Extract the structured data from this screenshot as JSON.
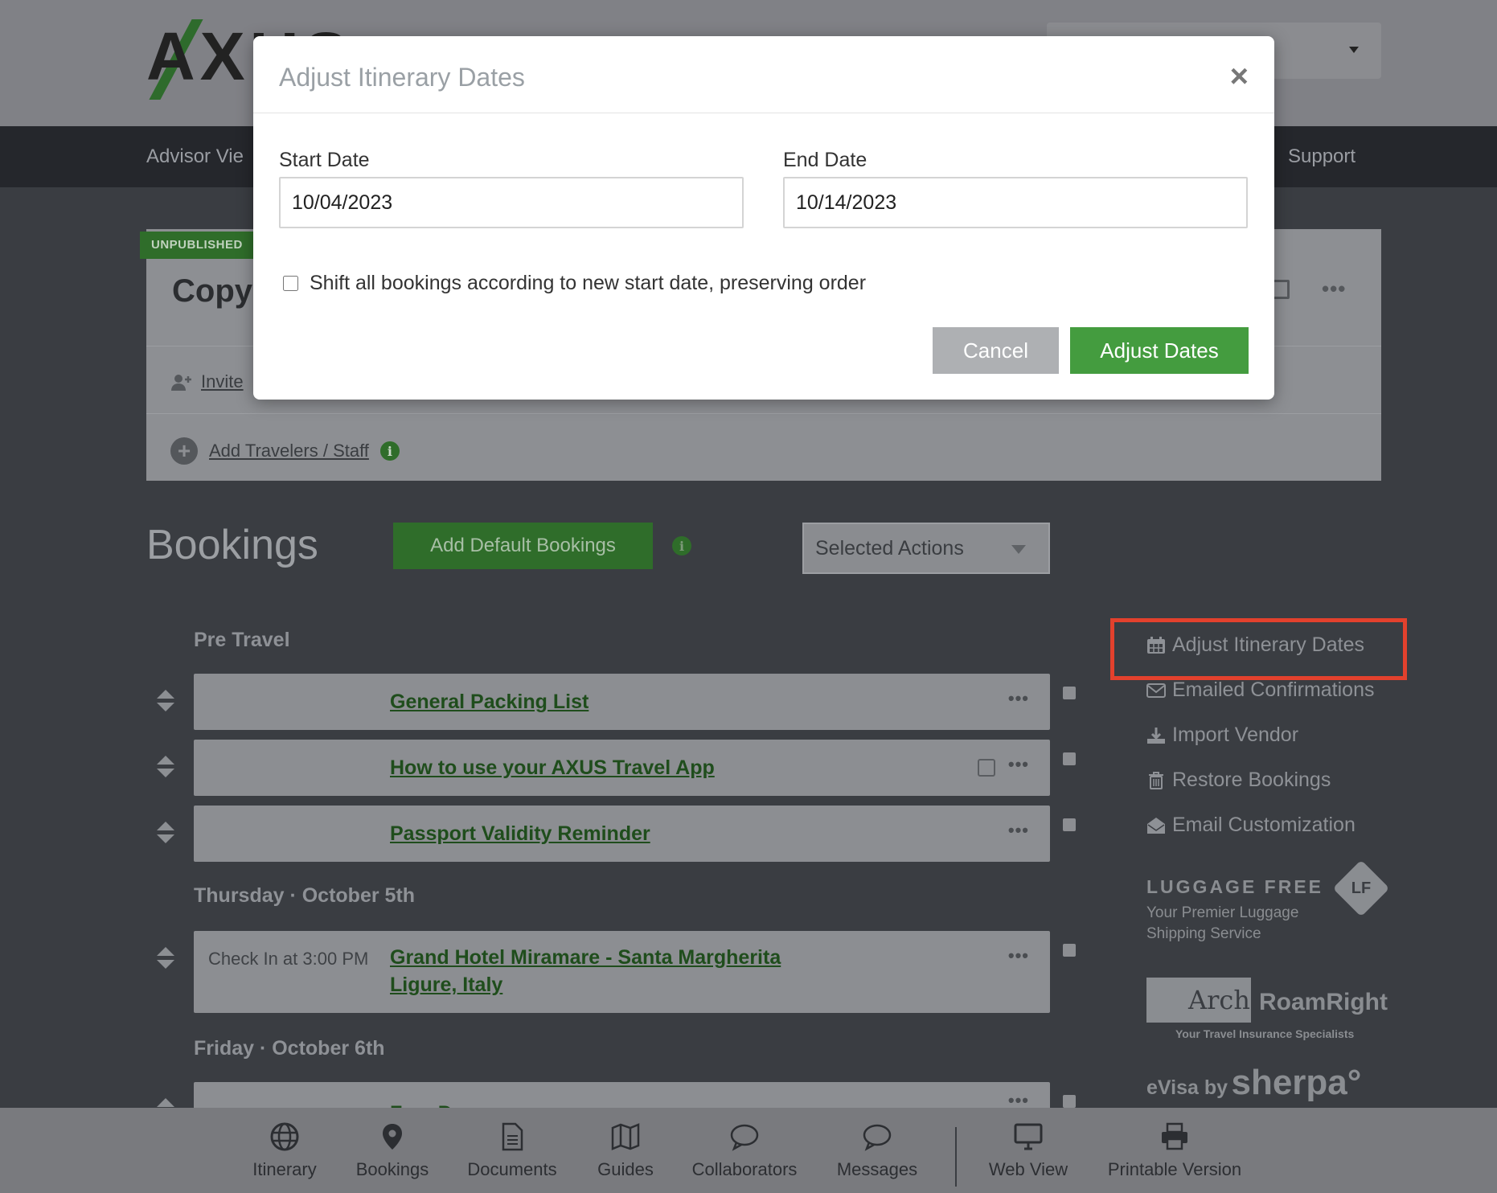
{
  "header": {
    "logo_text": "AXUS",
    "nav": {
      "advisor_view": "Advisor Vie",
      "support": "Support"
    }
  },
  "trip": {
    "status_badge": "UNPUBLISHED",
    "title": "Copy",
    "invite_label": "Invite",
    "add_travelers_label": "Add Travelers / Staff"
  },
  "bookings": {
    "title": "Bookings",
    "add_default_label": "Add Default Bookings",
    "selected_actions_label": "Selected Actions",
    "sections": [
      {
        "heading": "Pre Travel"
      },
      {
        "heading": "Thursday · October 5th"
      },
      {
        "heading": "Friday · October 6th"
      }
    ],
    "rows": [
      {
        "title": "General Packing List",
        "time": ""
      },
      {
        "title": "How to use your AXUS Travel App",
        "time": ""
      },
      {
        "title": "Passport Validity Reminder",
        "time": ""
      },
      {
        "title_line1": "Grand Hotel Miramare - Santa Margherita",
        "title_line2": "Ligure, Italy",
        "time": "Check In at 3:00 PM"
      },
      {
        "title": "Free Day",
        "time": ""
      }
    ]
  },
  "sidebar": {
    "links": [
      {
        "label": "Adjust Itinerary Dates",
        "icon": "calendar-icon"
      },
      {
        "label": "Emailed Confirmations",
        "icon": "envelope-icon"
      },
      {
        "label": "Import Vendor",
        "icon": "download-icon"
      },
      {
        "label": "Restore Bookings",
        "icon": "trash-icon"
      },
      {
        "label": "Email Customization",
        "icon": "open-envelope-icon"
      }
    ],
    "partners": {
      "luggage_free": {
        "name": "LUGGAGE FREE",
        "tagline_1": "Your Premier Luggage",
        "tagline_2": "Shipping Service",
        "badge": "LF"
      },
      "arch": {
        "name": "Arch",
        "right": "RoamRight",
        "tagline": "Your Travel Insurance Specialists"
      },
      "sherpa": {
        "prefix": "eVisa by",
        "name": "sherpa°"
      }
    }
  },
  "bottom_tabs": [
    {
      "label": "Itinerary",
      "icon": "globe-icon"
    },
    {
      "label": "Bookings",
      "icon": "map-pin-icon"
    },
    {
      "label": "Documents",
      "icon": "document-icon"
    },
    {
      "label": "Guides",
      "icon": "map-icon"
    },
    {
      "label": "Collaborators",
      "icon": "chat-bubble-icon"
    },
    {
      "label": "Messages",
      "icon": "message-icon"
    },
    {
      "label": "Web View",
      "icon": "monitor-icon"
    },
    {
      "label": "Printable Version",
      "icon": "printer-icon"
    }
  ],
  "modal": {
    "title": "Adjust Itinerary Dates",
    "close_glyph": "×",
    "start_label": "Start Date",
    "start_value": "10/04/2023",
    "end_label": "End Date",
    "end_value": "10/14/2023",
    "shift_label": "Shift all bookings according to new start date, preserving order",
    "shift_checked": false,
    "cancel_label": "Cancel",
    "submit_label": "Adjust Dates"
  },
  "colors": {
    "brand_green": "#449c3f",
    "highlight": "#e3412d"
  }
}
